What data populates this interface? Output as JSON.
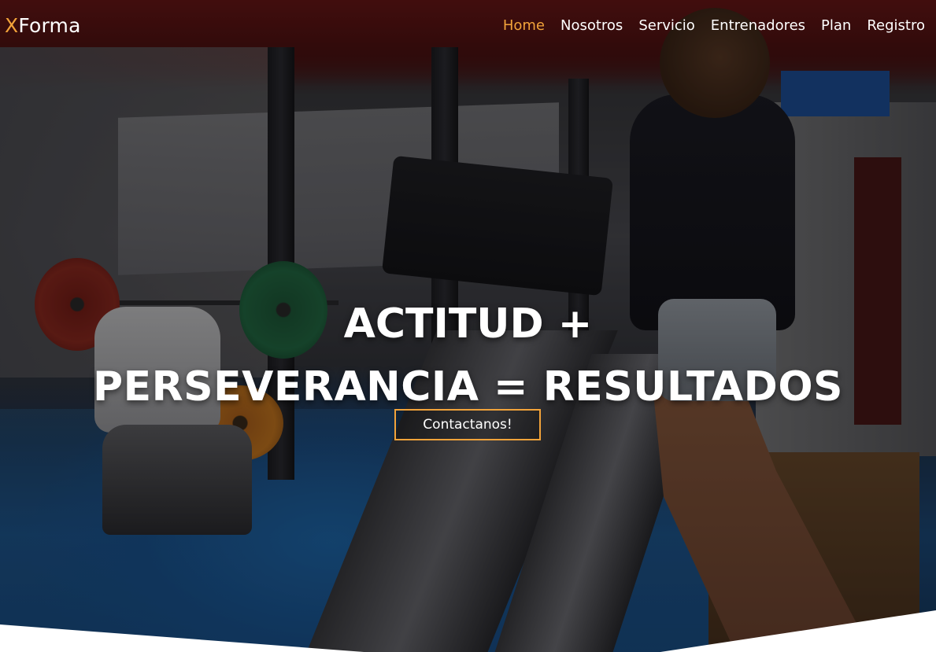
{
  "brand": {
    "accent_letter": "X",
    "rest": "Forma"
  },
  "nav": {
    "items": [
      {
        "label": "Home",
        "active": true
      },
      {
        "label": "Nosotros",
        "active": false
      },
      {
        "label": "Servicio",
        "active": false
      },
      {
        "label": "Entrenadores",
        "active": false
      },
      {
        "label": "Plan",
        "active": false
      },
      {
        "label": "Registro",
        "active": false
      }
    ]
  },
  "hero": {
    "headline_line1": "ACTITUD +",
    "headline_line2": "PERSEVERANCIA = RESULTADOS",
    "cta_label": "Contactanos!",
    "background_image": "gym-photo"
  },
  "colors": {
    "accent": "#f2a33a",
    "text": "#ffffff"
  }
}
